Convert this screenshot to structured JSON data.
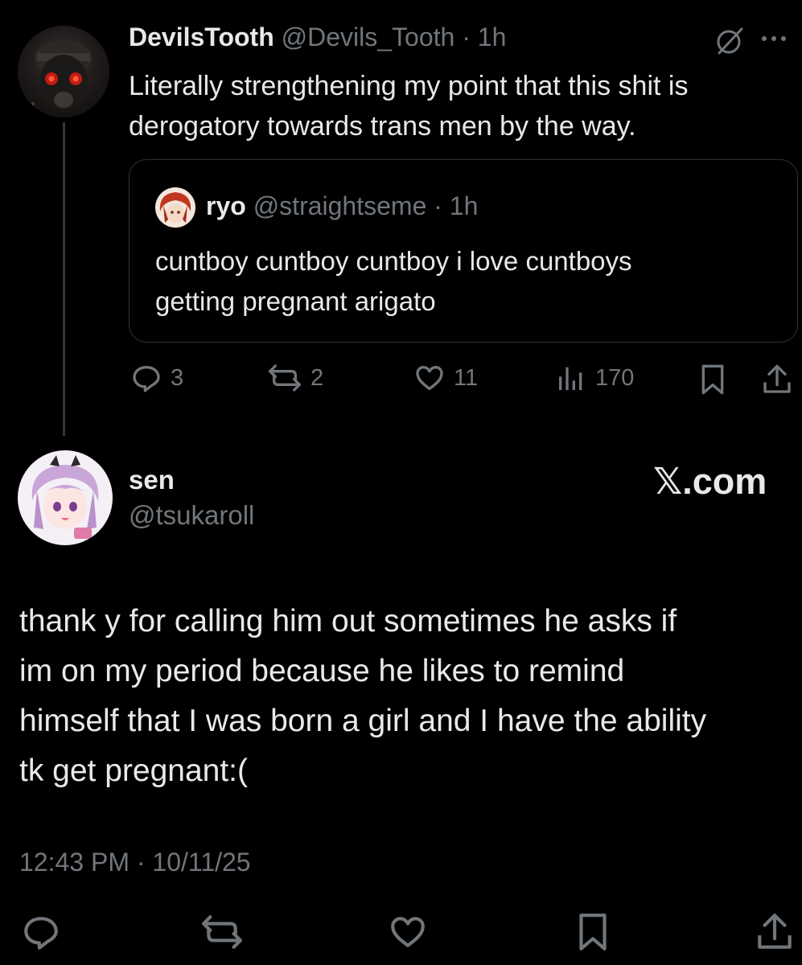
{
  "top_tweet": {
    "avatar_icon": "gas-mask-avatar",
    "display_name": "DevilsTooth",
    "handle_time": "@Devils_Tooth · 1h",
    "text_line1": "Literally strengthening my point that this shit is",
    "text_line2": "derogatory towards trans men by the way.",
    "quote": {
      "avatar_icon": "red-hair-avatar",
      "display_name": "ryo",
      "handle_time": "@straightseme · 1h",
      "text_line1": "cuntboy cuntboy cuntboy i love cuntboys",
      "text_line2": "getting pregnant arigato"
    },
    "actions": {
      "replies": "3",
      "reposts": "2",
      "likes": "11",
      "views": "170"
    }
  },
  "main_tweet": {
    "avatar_icon": "anime-girl-avatar",
    "display_name": "sen",
    "handle": "@tsukaroll",
    "brand": "𝕏.com",
    "text_lines": [
      "thank y for calling him out sometimes he asks if",
      "im on my period because he likes to remind",
      "himself that I was born a girl and I have the ability",
      "tk get pregnant:("
    ],
    "timestamp": "12:43 PM · 10/11/25"
  },
  "colors": {
    "background": "#000000",
    "text": "#e7e9ea",
    "muted": "#71767b",
    "border": "#2f3336"
  }
}
